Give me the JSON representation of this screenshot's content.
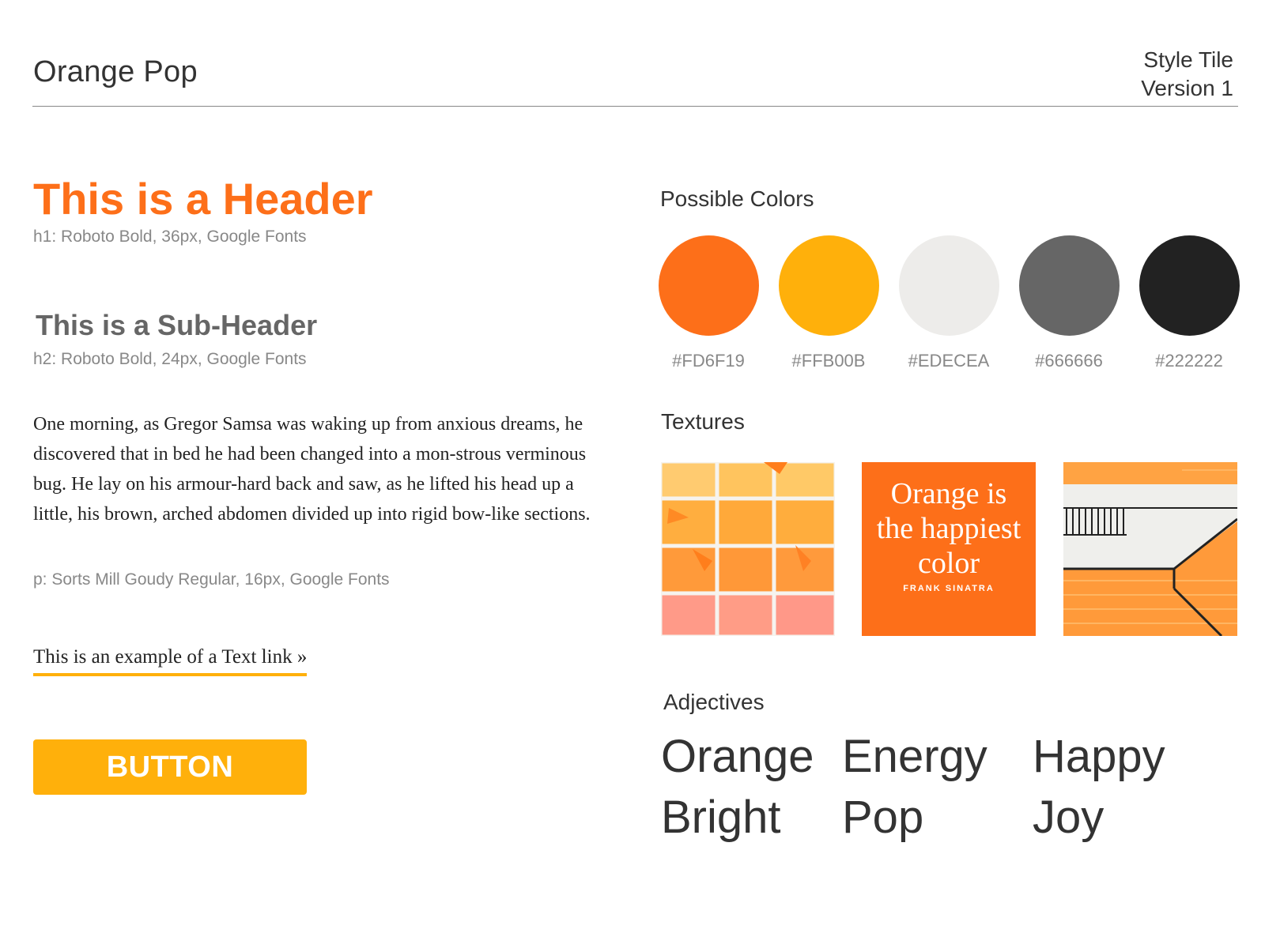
{
  "header": {
    "brand": "Orange Pop",
    "meta_line1": "Style Tile",
    "meta_line2": "Version 1"
  },
  "typography": {
    "h1_sample": "This is a Header",
    "h1_spec": "h1: Roboto Bold, 36px, Google Fonts",
    "h2_sample": "This is a Sub-Header",
    "h2_spec": "h2: Roboto Bold, 24px, Google Fonts",
    "paragraph": "One morning, as Gregor Samsa was waking up from anxious dreams, he discovered that in bed he had been changed into a mon-strous verminous bug. He lay on his armour-hard back and saw, as he lifted his head up a little, his brown, arched abdomen divided up into rigid bow-like sections.",
    "p_spec": "p: Sorts Mill Goudy Regular, 16px, Google Fonts",
    "link_text": "This is an example of a Text link »",
    "button_label": "BUTTON"
  },
  "colors": {
    "label": "Possible Colors",
    "swatches": [
      {
        "hex": "#FD6F19",
        "label": "#FD6F19"
      },
      {
        "hex": "#FFB00B",
        "label": "#FFB00B"
      },
      {
        "hex": "#EDECEA",
        "label": "#EDECEA"
      },
      {
        "hex": "#666666",
        "label": "#666666"
      },
      {
        "hex": "#222222",
        "label": "#222222"
      }
    ]
  },
  "textures": {
    "label": "Textures",
    "quote_line1": "Orange is",
    "quote_line2": "the happiest",
    "quote_line3": "color",
    "quote_author": "FRANK SINATRA"
  },
  "adjectives": {
    "label": "Adjectives",
    "words": [
      "Orange",
      "Energy",
      "Happy",
      "Bright",
      "Pop",
      "Joy"
    ]
  }
}
